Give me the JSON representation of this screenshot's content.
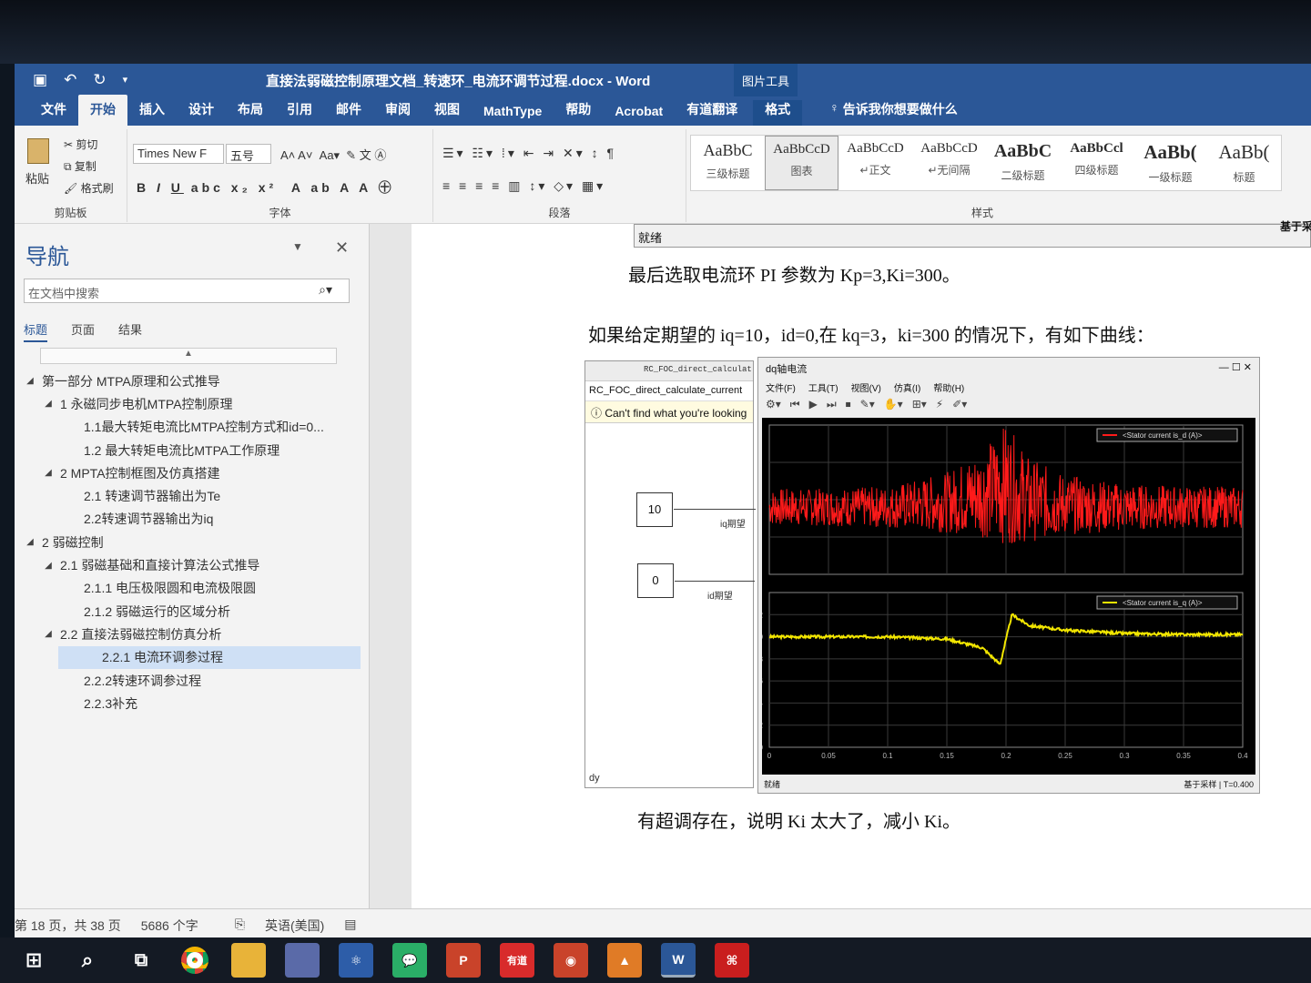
{
  "window": {
    "title": "直接法弱磁控制原理文档_转速环_电流环调节过程.docx  -  Word",
    "context_group": "图片工具"
  },
  "tabs": [
    "文件",
    "开始",
    "插入",
    "设计",
    "布局",
    "引用",
    "邮件",
    "审阅",
    "视图",
    "MathType",
    "帮助",
    "Acrobat",
    "有道翻译",
    "格式"
  ],
  "tell_me": "告诉我你想要做什么",
  "ribbon": {
    "clipboard": {
      "paste": "粘贴",
      "cut": "剪切",
      "copy": "复制",
      "format_painter": "格式刷",
      "label": "剪贴板"
    },
    "font": {
      "name": "Times New F",
      "size": "五号",
      "label": "字体"
    },
    "paragraph": {
      "label": "段落"
    },
    "styles": {
      "label": "样式",
      "items": [
        {
          "preview": "AaBbC",
          "name": "三级标题"
        },
        {
          "preview": "AaBbCcD",
          "name": "图表"
        },
        {
          "preview": "AaBbCcD",
          "name": "↵正文"
        },
        {
          "preview": "AaBbCcD",
          "name": "↵无间隔"
        },
        {
          "preview": "AaBbC",
          "name": "二级标题"
        },
        {
          "preview": "AaBbCcl",
          "name": "四级标题"
        },
        {
          "preview": "AaBb(",
          "name": "一级标题"
        },
        {
          "preview": "AaBb(",
          "name": "标题"
        }
      ]
    }
  },
  "nav": {
    "title": "导航",
    "search_placeholder": "在文档中搜索",
    "tabs": [
      "标题",
      "页面",
      "结果"
    ],
    "tree": [
      {
        "label": "第一部分 MTPA原理和公式推导",
        "level": 0,
        "arrow": "◢"
      },
      {
        "label": "1 永磁同步电机MTPA控制原理",
        "level": 1,
        "arrow": "◢"
      },
      {
        "label": "1.1最大转矩电流比MTPA控制方式和id=0...",
        "level": 2,
        "arrow": ""
      },
      {
        "label": "1.2 最大转矩电流比MTPA工作原理",
        "level": 2,
        "arrow": ""
      },
      {
        "label": "2 MPTA控制框图及仿真搭建",
        "level": 1,
        "arrow": "◢"
      },
      {
        "label": "2.1 转速调节器输出为Te",
        "level": 2,
        "arrow": ""
      },
      {
        "label": "2.2转速调节器输出为iq",
        "level": 2,
        "arrow": ""
      },
      {
        "label": "2 弱磁控制",
        "level": 0,
        "arrow": "◢"
      },
      {
        "label": "2.1 弱磁基础和直接计算法公式推导",
        "level": 1,
        "arrow": "◢"
      },
      {
        "label": "2.1.1 电压极限圆和电流极限圆",
        "level": 2,
        "arrow": ""
      },
      {
        "label": "2.1.2 弱磁运行的区域分析",
        "level": 2,
        "arrow": ""
      },
      {
        "label": "2.2 直接法弱磁控制仿真分析",
        "level": 1,
        "arrow": "◢"
      },
      {
        "label": "2.2.1 电流环调参过程",
        "level": 2,
        "arrow": "",
        "selected": true
      },
      {
        "label": "2.2.2转速环调参过程",
        "level": 2,
        "arrow": ""
      },
      {
        "label": "2.2.3补充",
        "level": 2,
        "arrow": ""
      }
    ]
  },
  "document": {
    "strip_label": "就绪",
    "line1": "最后选取电流环 PI 参数为 Kp=3,Ki=300。",
    "line2": "如果给定期望的 iq=10，id=0,在 kq=3，ki=300 的情况下，有如下曲线：",
    "line3": "有超调存在，说明 Ki 太大了，减小 Ki。",
    "right_tag": "基于采"
  },
  "simulink": {
    "tab": "RC_FOC_direct_calculat",
    "path": "RC_FOC_direct_calculate_current",
    "warning": "Can't find what you're looking",
    "blocks": [
      {
        "value": "10",
        "label": "iq期望"
      },
      {
        "value": "0",
        "label": "id期望"
      }
    ],
    "footer": "dy"
  },
  "scope": {
    "title": "dq轴电流",
    "menu": [
      "文件(F)",
      "工具(T)",
      "视图(V)",
      "仿真(I)",
      "帮助(H)"
    ],
    "legend_top": "<Stator current is_d (A)>",
    "legend_bottom": "<Stator current is_q (A)>",
    "status_left": "就绪",
    "status_mid": "基于采样",
    "status_right": "T=0.400",
    "colors": {
      "top": "#ff1a1a",
      "bottom": "#f2e600",
      "grid": "#3a3a3a"
    }
  },
  "chart_data": [
    {
      "type": "line",
      "title": "",
      "series": [
        {
          "name": "<Stator current is_d (A)>",
          "x": [
            0,
            0.05,
            0.1,
            0.15,
            0.18,
            0.2,
            0.22,
            0.25,
            0.3,
            0.35,
            0.4
          ],
          "y": [
            0,
            0,
            0,
            0.2,
            0.6,
            1.0,
            0.3,
            0.1,
            0,
            0,
            0
          ]
        }
      ],
      "xlim": [
        0,
        0.4
      ],
      "noise_band": [
        0.8,
        0.8,
        0.9,
        1.3,
        1.9,
        2.6,
        1.8,
        1.3,
        1.0,
        0.9,
        0.9
      ]
    },
    {
      "type": "line",
      "title": "",
      "series": [
        {
          "name": "<Stator current is_q (A)>",
          "x": [
            0,
            0.05,
            0.1,
            0.15,
            0.18,
            0.195,
            0.205,
            0.22,
            0.25,
            0.3,
            0.35,
            0.4
          ],
          "y": [
            10,
            10,
            10,
            9.8,
            9.0,
            7.5,
            12.0,
            11.0,
            10.6,
            10.3,
            10.2,
            10.2
          ]
        }
      ],
      "xlim": [
        0,
        0.4
      ],
      "ylim": [
        0,
        14
      ],
      "yticks": [
        0,
        2,
        4,
        6,
        8,
        10,
        12
      ],
      "xticks": [
        "0",
        "0.05",
        "0.1",
        "0.15",
        "0.2",
        "0.25",
        "0.3",
        "0.35",
        "0.4"
      ]
    }
  ],
  "statusbar": {
    "page": "第 18 页，共 38 页",
    "words": "5686 个字",
    "lang": "英语(美国)"
  },
  "taskbar": [
    "windows-start",
    "search",
    "task-view",
    "chrome",
    "file-explorer",
    "app",
    "app",
    "wechat",
    "powerpoint",
    "youdao",
    "app",
    "matlab",
    "word",
    "acrobat"
  ]
}
